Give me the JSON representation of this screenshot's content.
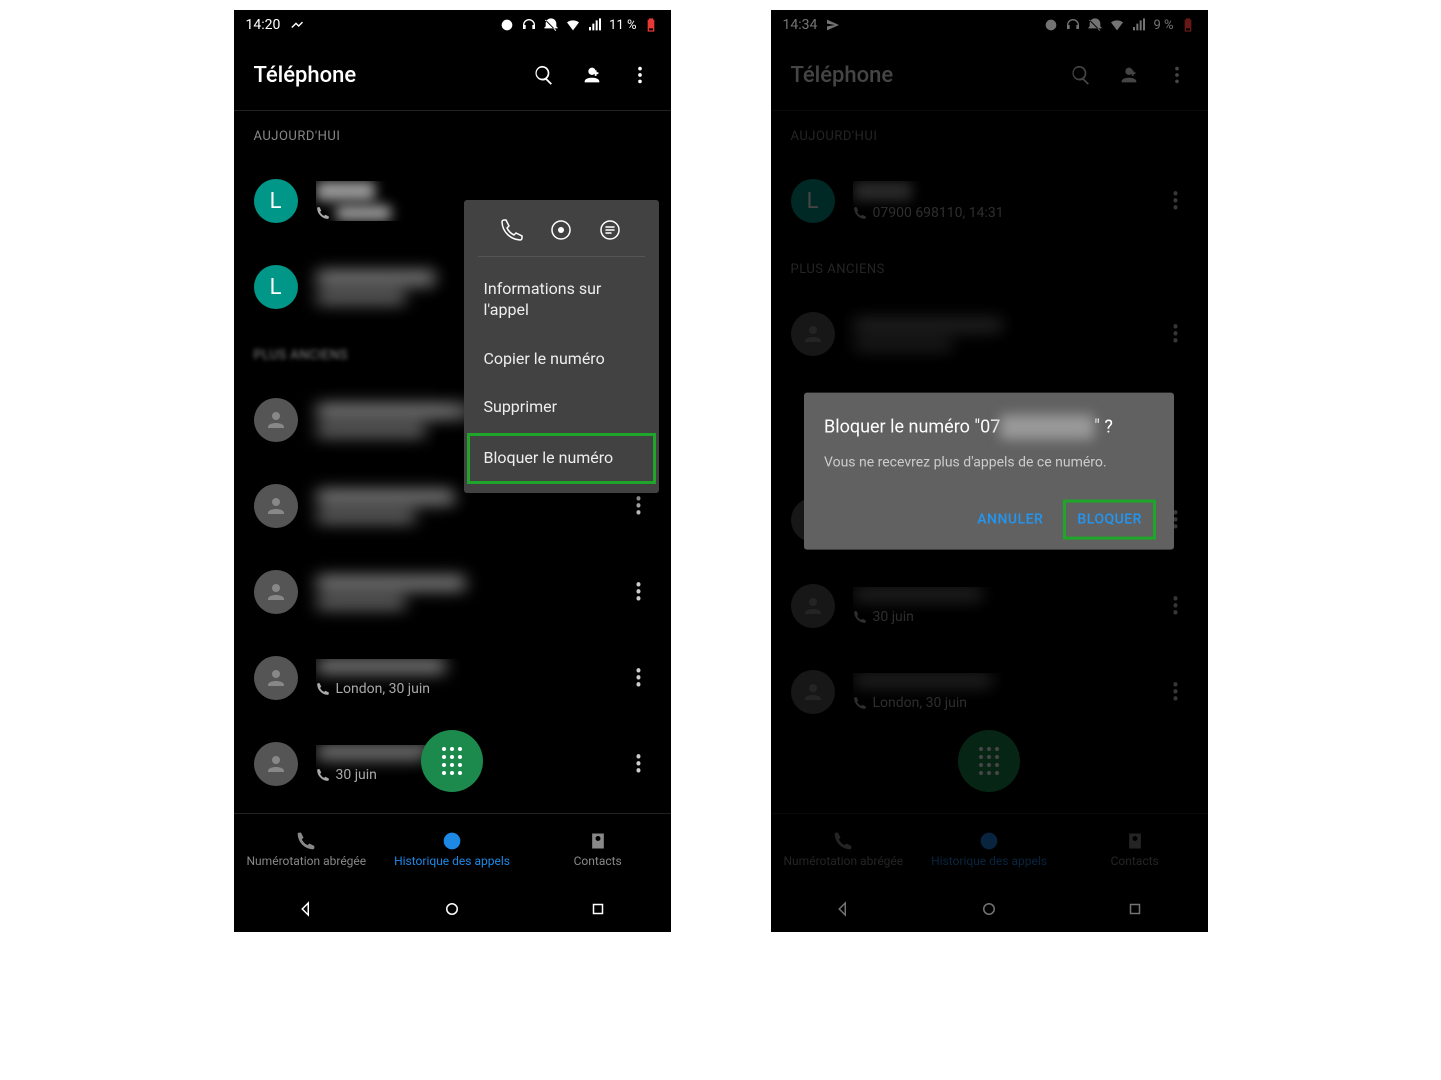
{
  "left": {
    "status": {
      "time": "14:20",
      "battery": "11 %"
    },
    "header": {
      "title": "Téléphone"
    },
    "sections": {
      "today": "AUJOURD'HUI",
      "older": "PLUS ANCIENS"
    },
    "popup": {
      "items": [
        "Informations sur l'appel",
        "Copier le numéro",
        "Supprimer",
        "Bloquer le numéro"
      ]
    },
    "calls": {
      "london": "London, 30 juin",
      "june30": "30 juin"
    },
    "nav": {
      "speed": "Numérotation abrégée",
      "history": "Historique des appels",
      "contacts": "Contacts"
    }
  },
  "right": {
    "status": {
      "time": "14:34",
      "battery": "9 %"
    },
    "header": {
      "title": "Téléphone"
    },
    "sections": {
      "today": "AUJOURD'HUI",
      "older": "PLUS ANCIENS"
    },
    "call1": {
      "sub": "07900 698110, 14:31"
    },
    "calls": {
      "june30": "30 juin",
      "london": "London, 30 juin"
    },
    "dialog": {
      "title_pre": "Bloquer le numéro \"07",
      "title_post": "\" ?",
      "msg": "Vous ne recevrez plus d'appels de ce numéro.",
      "cancel": "ANNULER",
      "block": "BLOQUER"
    },
    "nav": {
      "speed": "Numérotation abrégée",
      "history": "Historique des appels",
      "contacts": "Contacts"
    }
  }
}
